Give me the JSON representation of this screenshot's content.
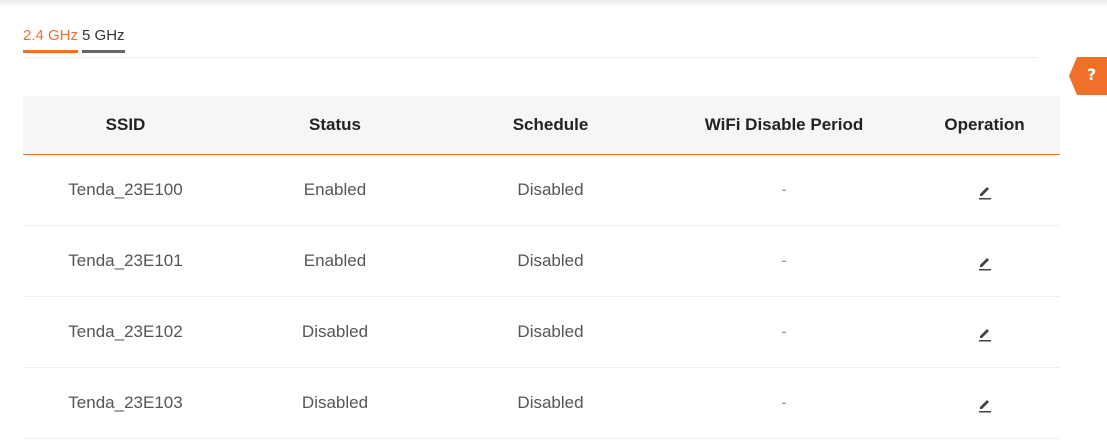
{
  "band_tabs": [
    {
      "label": "2.4 GHz",
      "active": true
    },
    {
      "label": "5 GHz",
      "active": false
    }
  ],
  "help": {
    "label": "?"
  },
  "table": {
    "headers": {
      "ssid": "SSID",
      "status": "Status",
      "schedule": "Schedule",
      "disable_period": "WiFi Disable Period",
      "operation": "Operation"
    },
    "rows": [
      {
        "ssid": "Tenda_23E100",
        "status": "Enabled",
        "schedule": "Disabled",
        "disable_period": "-",
        "operation_icon": "edit-icon"
      },
      {
        "ssid": "Tenda_23E101",
        "status": "Enabled",
        "schedule": "Disabled",
        "disable_period": "-",
        "operation_icon": "edit-icon"
      },
      {
        "ssid": "Tenda_23E102",
        "status": "Disabled",
        "schedule": "Disabled",
        "disable_period": "-",
        "operation_icon": "edit-icon"
      },
      {
        "ssid": "Tenda_23E103",
        "status": "Disabled",
        "schedule": "Disabled",
        "disable_period": "-",
        "operation_icon": "edit-icon"
      }
    ]
  },
  "colors": {
    "accent": "#f0702a",
    "header_bg": "#f6f6f6",
    "text": "#555555"
  }
}
